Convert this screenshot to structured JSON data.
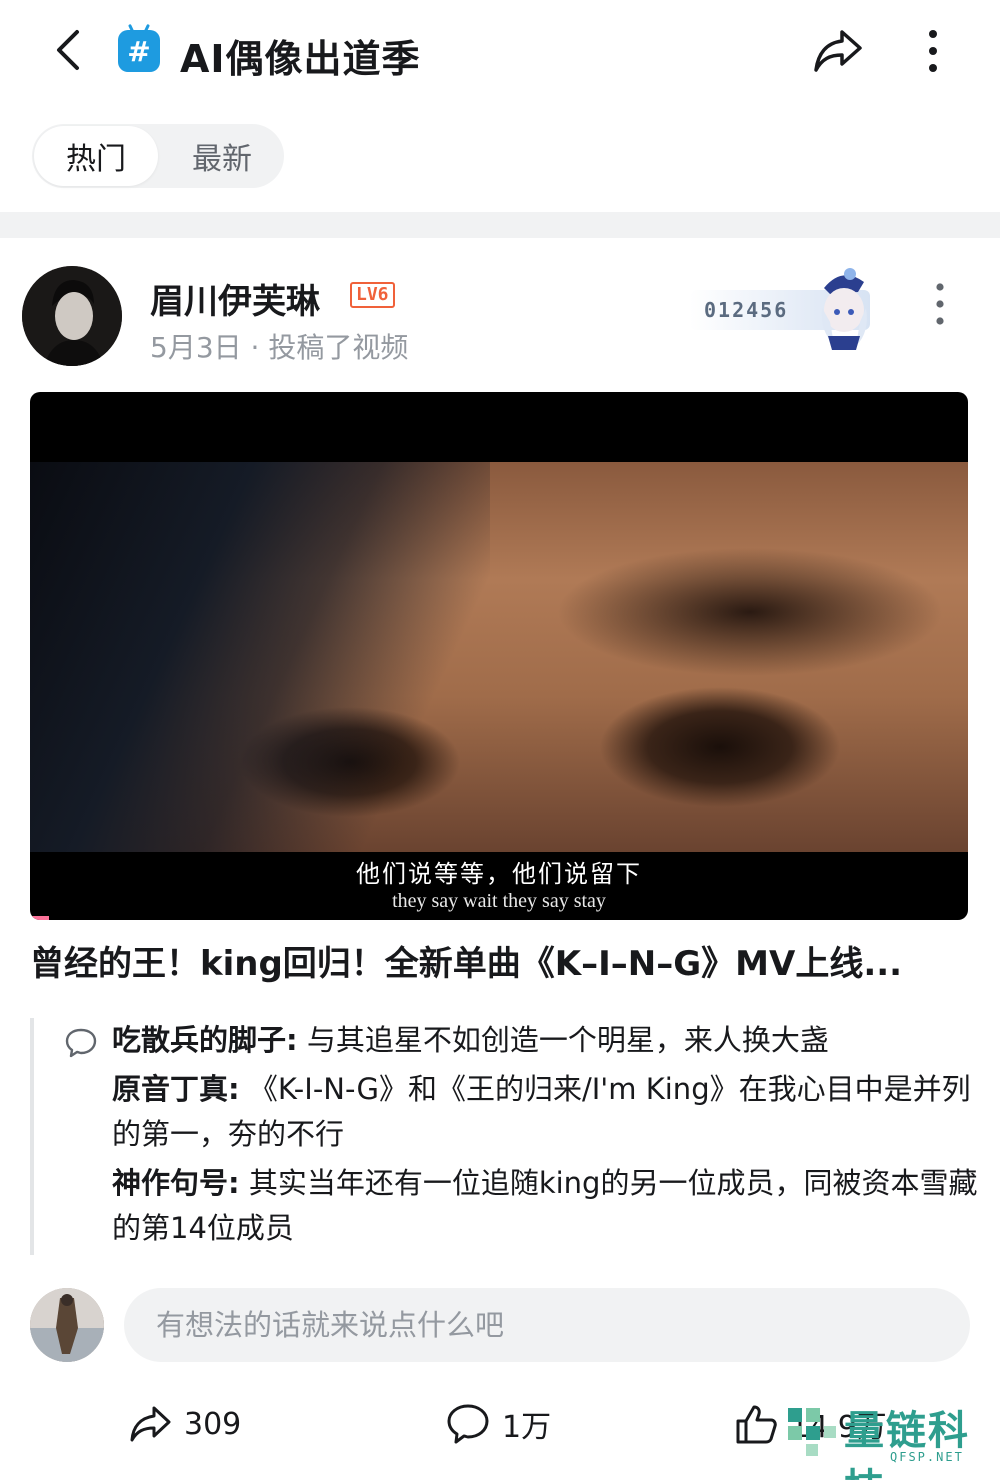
{
  "header": {
    "title": "AI偶像出道季",
    "topic_icon_glyph": "#",
    "icons": [
      "back-arrow-icon",
      "topic-hashtag-icon",
      "share-icon",
      "more-vertical-icon"
    ]
  },
  "tabs": [
    {
      "label": "热门",
      "active": true
    },
    {
      "label": "最新",
      "active": false
    }
  ],
  "post": {
    "author": "眉川伊芙琳",
    "level": "LV6",
    "date": "5月3日",
    "meta_separator": " · ",
    "action": "投稿了视频",
    "fan_badge_number": "012456",
    "video": {
      "subtitle_cn": "他们说等等，他们说留下",
      "subtitle_en": "they say wait they say stay",
      "progress": 0.02
    },
    "title": "曾经的王！king回归！全新单曲《K–I–N–G》MV上线..."
  },
  "comments": [
    {
      "author": "吃散兵的脚子:",
      "text": " 与其追星不如创造一个明星，来人换大盏"
    },
    {
      "author": "原音丁真:",
      "text": " 《K-I-N-G》和《王的归来/I'm King》在我心目中是并列的第一，夯的不行"
    },
    {
      "author": "神作句号:",
      "text": " 其实当年还有一位追随king的另一位成员，同被资本雪藏的第14位成员"
    }
  ],
  "comment_input": {
    "placeholder": "有想法的话就来说点什么吧"
  },
  "actions": {
    "share_count": "309",
    "comment_count": "1万",
    "like_count": "14.9万"
  },
  "watermark": {
    "text": "量链科技",
    "sub": "QFSP.NET"
  },
  "colors": {
    "accent_pink": "#fb7299",
    "level_orange": "#f0613a",
    "topic_blue": "#1e9be0",
    "muted_gray": "#9499a0",
    "watermark_teal": "#2e9e8e"
  }
}
